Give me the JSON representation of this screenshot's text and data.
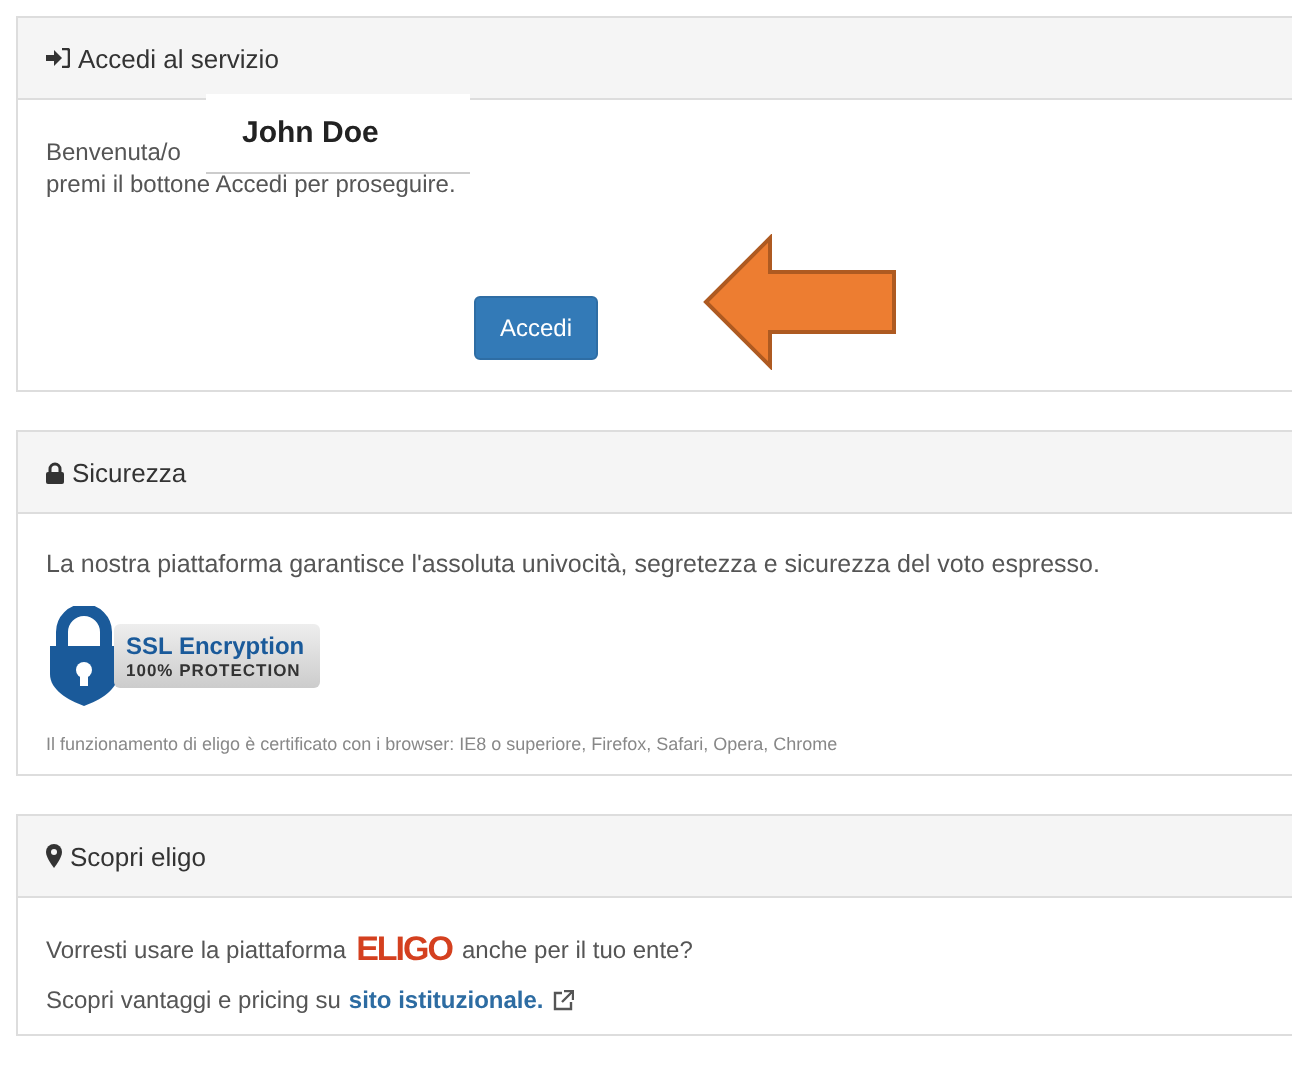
{
  "panels": [
    {
      "kind": "login",
      "title": "Accedi al servizio",
      "greeting": "Benvenuta/o",
      "user_name": "John Doe",
      "instruction": "premi il bottone Accedi per proseguire.",
      "button": "Accedi"
    },
    {
      "kind": "security",
      "title": "Sicurezza",
      "text": "La nostra piattaforma garantisce l'assoluta univocità, segretezza e sicurezza del voto espresso.",
      "badge_title": "SSL Encryption",
      "badge_subtitle": "100% PROTECTION",
      "note": "Il funzionamento di eligo è certificato con i browser: IE8 o superiore, Firefox, Safari, Opera, Chrome"
    },
    {
      "kind": "discover",
      "title": "Scopri eligo",
      "text_before": "Vorresti usare la piattaforma",
      "logo": "ELIGO",
      "text_after": "anche per il tuo ente?",
      "link_prefix": "Scopri vantaggi e pricing su",
      "link": "sito istituzionale."
    }
  ]
}
